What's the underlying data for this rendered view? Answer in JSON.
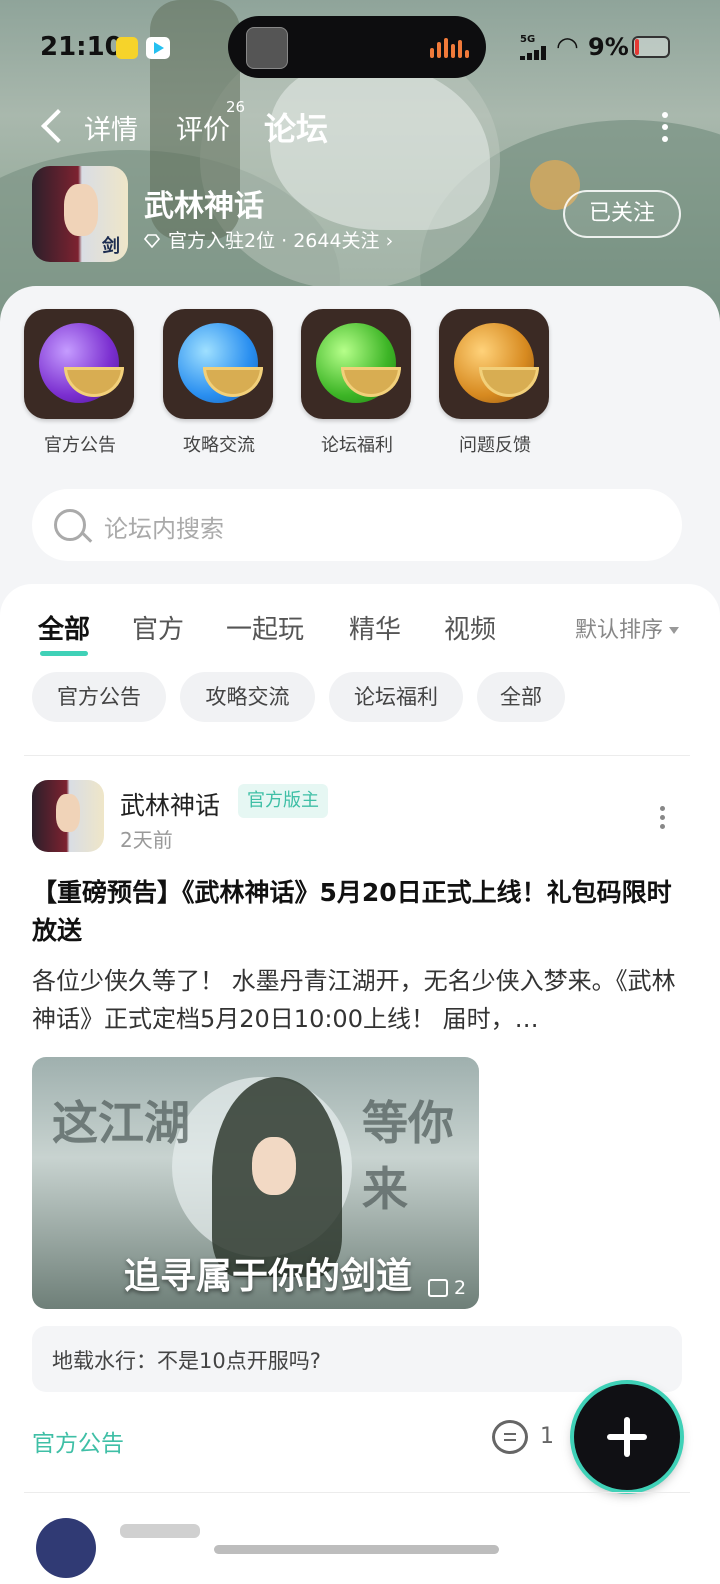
{
  "status_bar": {
    "time": "21:10",
    "network": "5G",
    "battery": "9%"
  },
  "nav": {
    "tabs": [
      "详情",
      "评价",
      "论坛"
    ],
    "review_count": "26",
    "active_tab": "论坛"
  },
  "game": {
    "name": "武林神话",
    "meta": "官方入驻2位 · 2644关注 ›",
    "follow_label": "已关注"
  },
  "categories": [
    {
      "label": "官方公告",
      "orb_color": "#7b2fd0"
    },
    {
      "label": "攻略交流",
      "orb_color": "#2a8ff0"
    },
    {
      "label": "论坛福利",
      "orb_color": "#3db526"
    },
    {
      "label": "问题反馈",
      "orb_color": "#d78a20"
    }
  ],
  "search": {
    "placeholder": "论坛内搜索"
  },
  "feed_tabs": [
    "全部",
    "官方",
    "一起玩",
    "精华",
    "视频"
  ],
  "sort_label": "默认排序",
  "chips": [
    "官方公告",
    "攻略交流",
    "论坛福利",
    "全部"
  ],
  "post": {
    "author": "武林神话",
    "badge": "官方版主",
    "time": "2天前",
    "title": "【重磅预告】《武林神话》5月20日正式上线！礼包码限时放送",
    "body": "各位少侠久等了！ 水墨丹青江湖开，无名少侠入梦来。《武林神话》正式定档5月20日10:00上线！ 届时，…",
    "image": {
      "calligraphy_left": "这江湖",
      "calligraphy_right": "等你来",
      "slogan": "追寻属于你的剑道",
      "image_count": "2"
    },
    "comment_preview": "地载水行：不是10点开服吗?",
    "tag": "官方公告",
    "comment_count": "1"
  },
  "colors": {
    "accent": "#3fd1b7",
    "tag_text": "#3fbfa6"
  },
  "icons": [
    "back-arrow-icon",
    "more-vertical-icon",
    "diamond-icon",
    "search-icon",
    "comment-icon",
    "image-icon",
    "plus-icon"
  ]
}
